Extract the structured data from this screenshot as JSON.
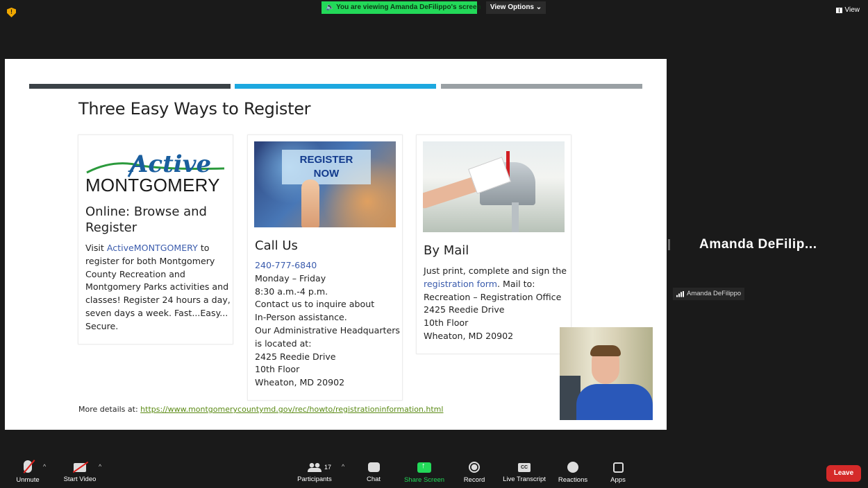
{
  "top": {
    "viewing_banner": "You are viewing Amanda DeFilippo's screen",
    "view_options": "View Options ⌄",
    "view_button": "View"
  },
  "slide": {
    "bar_colors": [
      "#3b4247",
      "#1da8df",
      "#9aa0a4"
    ],
    "title": "Three Easy Ways to Register",
    "online": {
      "logo_active": "Active",
      "logo_montgomery": "MONTGOMERY",
      "title_line1": "Online: Browse and",
      "title_line2": "Register",
      "body_prefix": "Visit ",
      "body_link": "ActiveMONTGOMERY",
      "body_lines": [
        " to",
        "register for both Montgomery",
        "County Recreation and",
        "Montgomery Parks activities and",
        "classes! Register 24 hours a day,",
        "seven days a week. Fast...Easy...",
        "Secure."
      ]
    },
    "phone": {
      "image_text_line1": "REGISTER",
      "image_text_line2": "NOW",
      "title": "Call Us",
      "phone_number": "240-777-6840",
      "lines": [
        "Monday – Friday",
        "8:30 a.m.-4 p.m.",
        "Contact us to inquire about",
        "In-Person assistance.",
        "Our Administrative Headquarters",
        "is located at:",
        "2425 Reedie Drive",
        "10th Floor",
        "Wheaton, MD 20902"
      ]
    },
    "mail": {
      "title": "By Mail",
      "line1": "Just print, complete and sign the",
      "link": "registration form",
      "line2_suffix": ". Mail to:",
      "lines": [
        "Recreation – Registration Office",
        "2425 Reedie Drive",
        "10th Floor",
        "Wheaton, MD 20902"
      ]
    },
    "details_label": "More details at: ",
    "details_url": "https://www.montgomerycountymd.gov/rec/howto/registrationinformation.html"
  },
  "speaker": {
    "name_large": "Amanda  DeFilip...",
    "name_tag": "Amanda DeFilippo"
  },
  "toolbar": {
    "unmute": "Unmute",
    "start_video": "Start Video",
    "participants": "Participants",
    "participants_count": "17",
    "chat": "Chat",
    "share_screen": "Share Screen",
    "record": "Record",
    "live_transcript": "Live Transcript",
    "reactions": "Reactions",
    "apps": "Apps",
    "leave": "Leave",
    "cc": "CC",
    "caret": "^"
  }
}
